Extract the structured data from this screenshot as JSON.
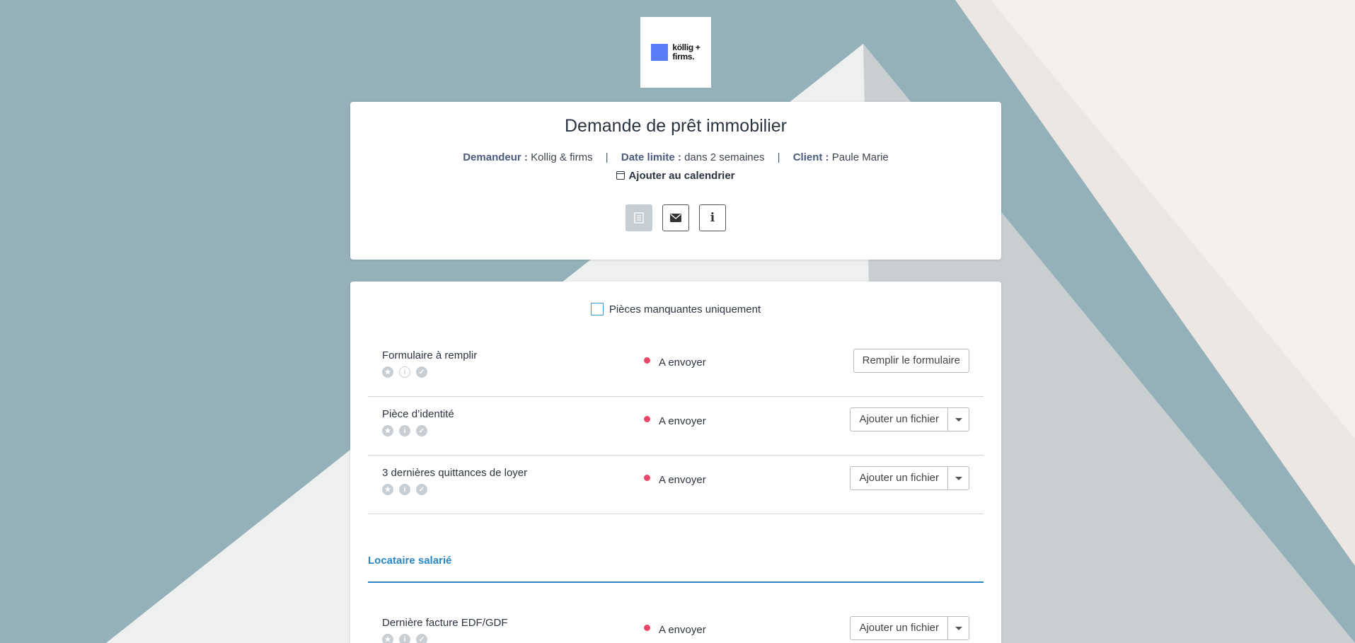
{
  "logo": {
    "line1": "köllig +",
    "line2": "firms."
  },
  "header": {
    "title": "Demande de prêt immobilier",
    "requester_label": "Demandeur :",
    "requester_value": "Kollig & firms",
    "deadline_label": "Date limite :",
    "deadline_value": "dans 2 semaines",
    "client_label": "Client :",
    "client_value": "Paule Marie",
    "separator": "|",
    "calendar_link": "Ajouter au calendrier"
  },
  "actions": {
    "info_glyph": "i",
    "icons": [
      "document-icon",
      "envelope-icon",
      "info-icon"
    ]
  },
  "filter": {
    "label": "Pièces manquantes uniquement",
    "checked": false
  },
  "rows": [
    {
      "name": "Formulaire à remplir",
      "status": "A envoyer",
      "button": "Remplir le formulaire",
      "has_dropdown": false
    },
    {
      "name": "Pièce d’identité",
      "status": "A envoyer",
      "button": "Ajouter un fichier",
      "has_dropdown": true
    },
    {
      "name": "3 dernières quittances de loyer",
      "status": "A envoyer",
      "button": "Ajouter un fichier",
      "has_dropdown": true
    }
  ],
  "section": {
    "title": "Locataire salarié",
    "rows": [
      {
        "name": "Dernière facture EDF/GDF",
        "status": "A envoyer",
        "button": "Ajouter un fichier",
        "has_dropdown": true
      }
    ]
  },
  "colors": {
    "accent": "#2a87c6",
    "status_dot": "#e8476a",
    "logo_square": "#5b7cfa",
    "background": "#94b0b9"
  }
}
